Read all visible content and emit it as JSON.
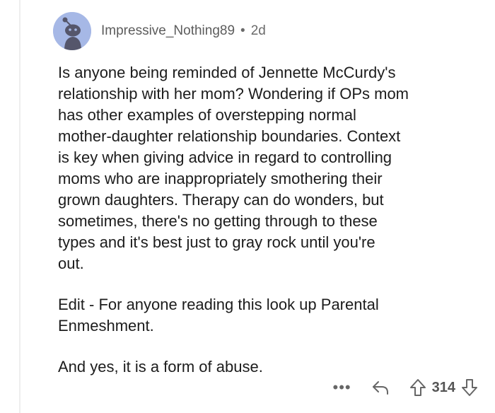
{
  "comment": {
    "username": "Impressive_Nothing89",
    "separator": "•",
    "time_ago": "2d",
    "paragraphs": [
      {
        "lines": [
          "Is anyone being reminded of Jennette McCurdy's",
          "relationship with her mom? Wondering if OPs mom",
          "has other examples of overstepping normal",
          "mother-daughter relationship boundaries. Context",
          "is key when giving advice in regard to controlling",
          "moms who are inappropriately smothering their",
          "grown daughters. Therapy can do wonders, but",
          "sometimes, there's no getting through to these",
          "types and it's best just to gray rock until you're",
          "out."
        ]
      },
      {
        "lines": [
          "Edit - For anyone reading this look up Parental",
          "Enmeshment."
        ]
      },
      {
        "lines": [
          "And yes, it is a form of abuse."
        ]
      }
    ],
    "actions": {
      "more_label": "•••",
      "vote_count": "314"
    }
  },
  "icons": {
    "avatar": "snoo-avatar-icon",
    "more": "more-options-icon",
    "reply": "reply-icon",
    "upvote": "upvote-arrow-icon",
    "downvote": "downvote-arrow-icon"
  },
  "colors": {
    "avatar_bg": "#a6b8e6",
    "meta_text": "#6a6a6a",
    "body_text": "#1c1c1c",
    "thread_line": "#eeeeee"
  }
}
